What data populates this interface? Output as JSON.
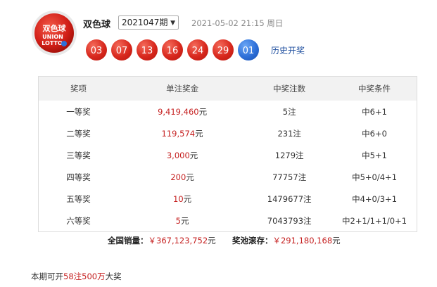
{
  "header": {
    "game_name": "双色球",
    "issue": "2021047期",
    "draw_date": "2021-05-02 21:15 周日",
    "history_link": "历史开奖",
    "logo_text": "双色球 UNION LOTTO"
  },
  "balls": {
    "red": [
      "03",
      "07",
      "13",
      "16",
      "24",
      "29"
    ],
    "blue": "01"
  },
  "colors": {
    "red_ball": "#d8281d",
    "blue_ball": "#2d6fd8",
    "money": "#c51f1f",
    "link": "#1f4f9f"
  },
  "table": {
    "headers": [
      "奖项",
      "单注奖金",
      "中奖注数",
      "中奖条件"
    ],
    "rows": [
      {
        "level": "一等奖",
        "amount": "9,419,460",
        "unit": "元",
        "count": "5注",
        "condition": "中6+1"
      },
      {
        "level": "二等奖",
        "amount": "119,574",
        "unit": "元",
        "count": "231注",
        "condition": "中6+0"
      },
      {
        "level": "三等奖",
        "amount": "3,000",
        "unit": "元",
        "count": "1279注",
        "condition": "中5+1"
      },
      {
        "level": "四等奖",
        "amount": "200",
        "unit": "元",
        "count": "77757注",
        "condition": "中5+0/4+1"
      },
      {
        "level": "五等奖",
        "amount": "10",
        "unit": "元",
        "count": "1479677注",
        "condition": "中4+0/3+1"
      },
      {
        "level": "六等奖",
        "amount": "5",
        "unit": "元",
        "count": "7043793注",
        "condition": "中2+1/1+1/0+1"
      }
    ]
  },
  "summary": {
    "sales_label": "全国销量：",
    "sales_value": "￥367,123,752",
    "sales_unit": "元",
    "pool_label": "奖池滚存：",
    "pool_value": "￥291,180,168",
    "pool_unit": "元"
  },
  "footnote": {
    "prefix": "本期可开",
    "highlight": "58注500万",
    "suffix": "大奖"
  }
}
